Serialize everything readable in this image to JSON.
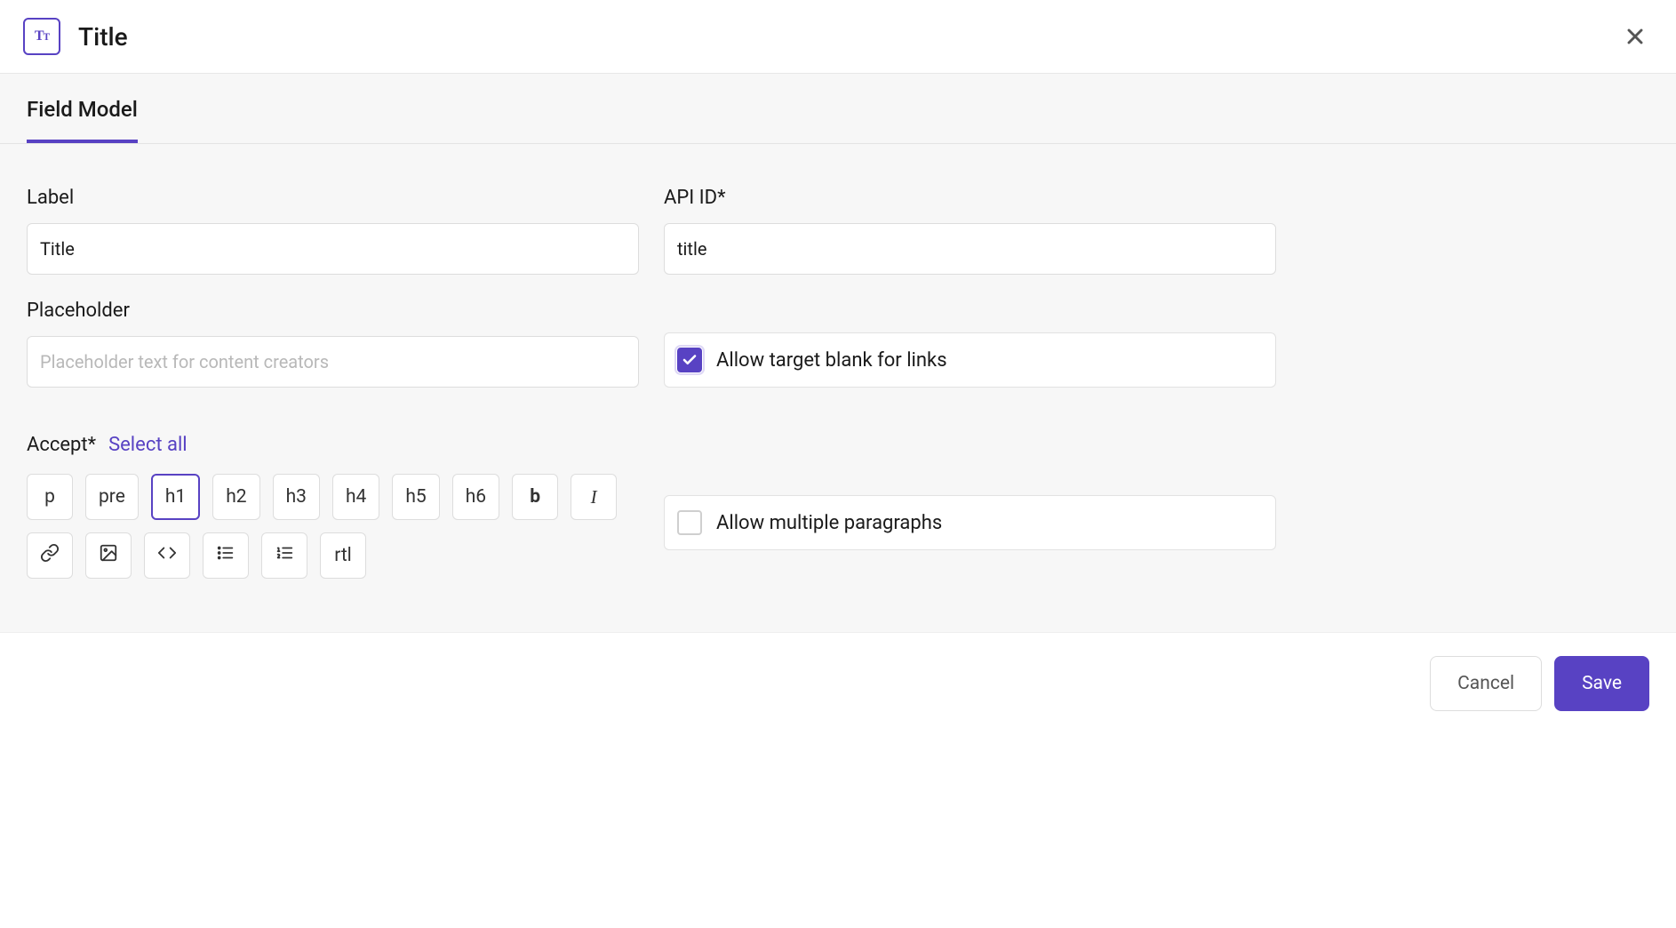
{
  "header": {
    "title": "Title"
  },
  "tabs": {
    "active": "Field Model"
  },
  "form": {
    "label_label": "Label",
    "label_value": "Title",
    "apiid_label": "API ID*",
    "apiid_value": "title",
    "placeholder_label": "Placeholder",
    "placeholder_placeholder": "Placeholder text for content creators",
    "allow_target_blank_label": "Allow target blank for links",
    "allow_target_blank_checked": true,
    "allow_multiple_label": "Allow multiple paragraphs",
    "allow_multiple_checked": false
  },
  "accept": {
    "label": "Accept*",
    "select_all": "Select all",
    "options": [
      {
        "key": "p",
        "label": "p",
        "selected": false,
        "style": ""
      },
      {
        "key": "pre",
        "label": "pre",
        "selected": false,
        "style": ""
      },
      {
        "key": "h1",
        "label": "h1",
        "selected": true,
        "style": ""
      },
      {
        "key": "h2",
        "label": "h2",
        "selected": false,
        "style": ""
      },
      {
        "key": "h3",
        "label": "h3",
        "selected": false,
        "style": ""
      },
      {
        "key": "h4",
        "label": "h4",
        "selected": false,
        "style": ""
      },
      {
        "key": "h5",
        "label": "h5",
        "selected": false,
        "style": ""
      },
      {
        "key": "h6",
        "label": "h6",
        "selected": false,
        "style": ""
      },
      {
        "key": "bold",
        "label": "b",
        "selected": false,
        "style": "bold"
      },
      {
        "key": "italic",
        "label": "I",
        "selected": false,
        "style": "italic"
      },
      {
        "key": "link",
        "label": "",
        "selected": false,
        "icon": "link"
      },
      {
        "key": "image",
        "label": "",
        "selected": false,
        "icon": "image"
      },
      {
        "key": "embed",
        "label": "",
        "selected": false,
        "icon": "code"
      },
      {
        "key": "ul",
        "label": "",
        "selected": false,
        "icon": "list-ul"
      },
      {
        "key": "ol",
        "label": "",
        "selected": false,
        "icon": "list-ol"
      },
      {
        "key": "rtl",
        "label": "rtl",
        "selected": false,
        "style": ""
      }
    ]
  },
  "footer": {
    "cancel": "Cancel",
    "save": "Save"
  }
}
